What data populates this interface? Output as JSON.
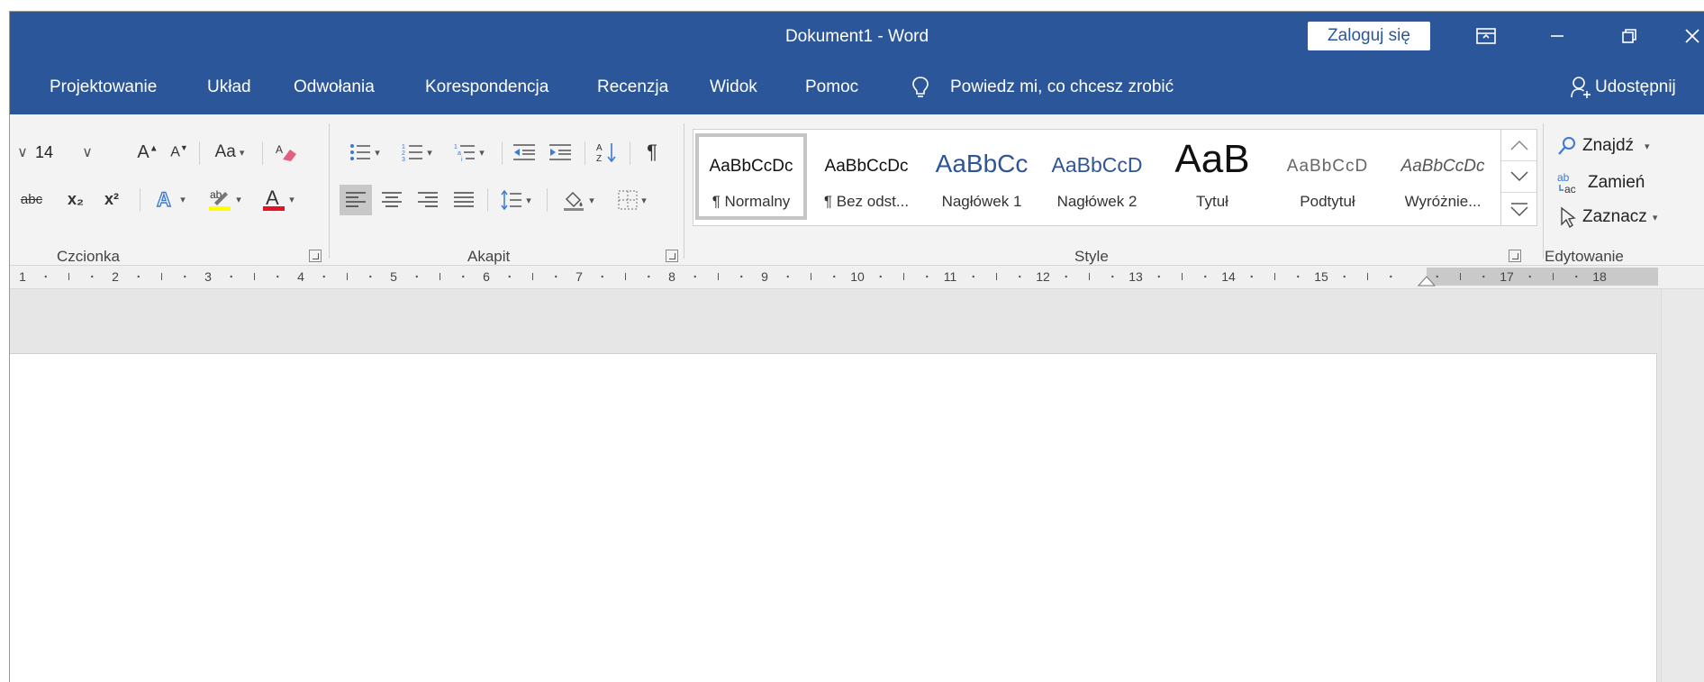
{
  "window": {
    "title": "Dokument1  -  Word",
    "login_label": "Zaloguj się",
    "controls": [
      "ribbon-options",
      "minimize",
      "restore",
      "close"
    ]
  },
  "tabs": [
    "Projektowanie",
    "Układ",
    "Odwołania",
    "Korespondencja",
    "Recenzja",
    "Widok",
    "Pomoc"
  ],
  "tell_me": "Powiedz mi, co chcesz zrobić",
  "share_label": "Udostępnij",
  "font_group": {
    "label": "Czcionka",
    "font_size": "14",
    "change_case_label": "Aa",
    "strikethrough_label": "abc",
    "subscript_label": "x₂",
    "superscript_label": "x²",
    "highlight_color": "#ffff00",
    "font_color": "#e81123"
  },
  "paragraph_group": {
    "label": "Akapit"
  },
  "styles_group": {
    "label": "Style",
    "items": [
      {
        "sample": "AaBbCcDc",
        "name": "¶ Normalny",
        "selected": true
      },
      {
        "sample": "AaBbCcDc",
        "name": "¶ Bez odst..."
      },
      {
        "sample": "AaBbCc",
        "name": "Nagłówek 1"
      },
      {
        "sample": "AaBbCcD",
        "name": "Nagłówek 2"
      },
      {
        "sample": "AaB",
        "name": "Tytuł"
      },
      {
        "sample": "AaBbCcD",
        "name": "Podtytuł"
      },
      {
        "sample": "AaBbCcDc",
        "name": "Wyróżnie..."
      }
    ]
  },
  "editing_group": {
    "label": "Edytowanie",
    "find_label": "Znajdź",
    "replace_label": "Zamień",
    "select_label": "Zaznacz"
  },
  "ruler": {
    "labels": [
      "1",
      "2",
      "3",
      "4",
      "5",
      "6",
      "7",
      "8",
      "9",
      "10",
      "11",
      "12",
      "13",
      "14",
      "15",
      "17",
      "18"
    ]
  },
  "colors": {
    "accent": "#2b579a",
    "ribbon": "#f3f3f3",
    "workspace": "#e6e6e6"
  }
}
